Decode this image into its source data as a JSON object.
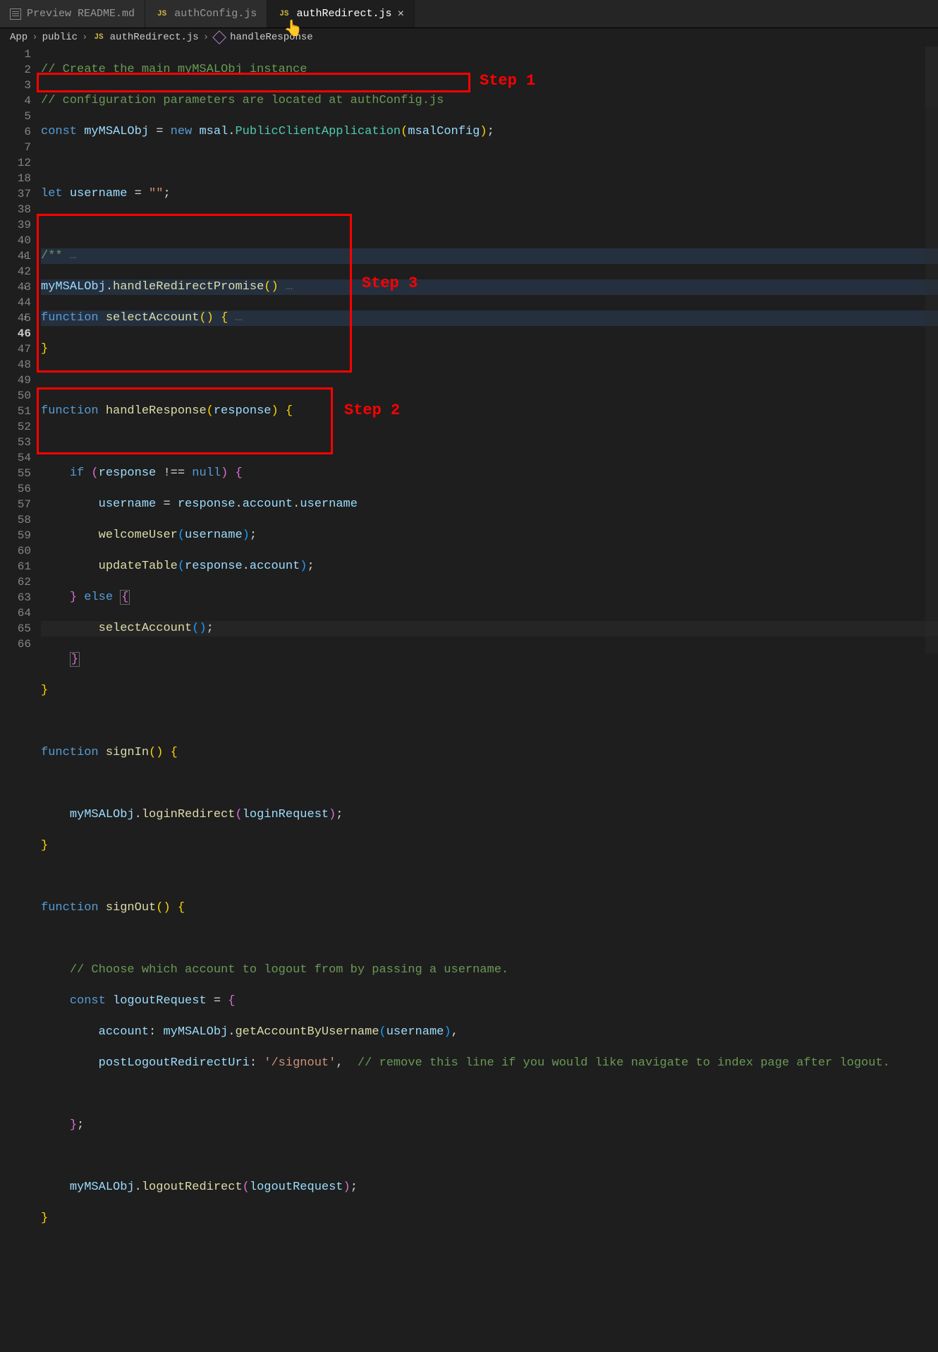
{
  "tabs": [
    {
      "icon": "preview",
      "label": "Preview README.md",
      "active": false
    },
    {
      "icon": "js",
      "label": "authConfig.js",
      "active": false
    },
    {
      "icon": "js",
      "label": "authRedirect.js",
      "active": true,
      "closable": true
    }
  ],
  "breadcrumb": [
    "App",
    "public",
    "authRedirect.js",
    "handleResponse"
  ],
  "line_numbers": [
    "1",
    "2",
    "3",
    "4",
    "5",
    "6",
    "7",
    "12",
    "18",
    "37",
    "38",
    "39",
    "40",
    "41",
    "42",
    "43",
    "44",
    "45",
    "46",
    "47",
    "48",
    "49",
    "50",
    "51",
    "52",
    "53",
    "54",
    "55",
    "56",
    "57",
    "58",
    "59",
    "60",
    "61",
    "62",
    "63",
    "64",
    "65",
    "66"
  ],
  "code": {
    "c1": "// Create the main myMSALObj instance",
    "c2": "// configuration parameters are located at authConfig.js",
    "kw_const": "const",
    "kw_let": "let",
    "kw_new": "new",
    "kw_function": "function",
    "kw_if": "if",
    "kw_else": "else",
    "kw_null": "null",
    "myMSALObj": "myMSALObj",
    "msal": "msal",
    "PublicClientApplication": "PublicClientApplication",
    "msalConfig": "msalConfig",
    "username": "username",
    "empty": "\"\"",
    "handleRedirectPromise": "handleRedirectPromise",
    "selectAccount": "selectAccount",
    "handleResponse": "handleResponse",
    "response": "response",
    "account": "account",
    "welcomeUser": "welcomeUser",
    "updateTable": "updateTable",
    "signIn": "signIn",
    "loginRedirect": "loginRedirect",
    "loginRequest": "loginRequest",
    "signOut": "signOut",
    "c3": "// Choose which account to logout from by passing a username.",
    "logoutRequest": "logoutRequest",
    "getAccountByUsername": "getAccountByUsername",
    "postLogoutRedirectUri": "postLogoutRedirectUri",
    "signout_str": "'/signout'",
    "c4": "// remove this line if you would like navigate to index page after logout.",
    "logoutRedirect": "logoutRedirect",
    "jsdoc": "/**"
  },
  "annotations": {
    "step1": "Step 1",
    "step2": "Step 2",
    "step3": "Step 3"
  }
}
